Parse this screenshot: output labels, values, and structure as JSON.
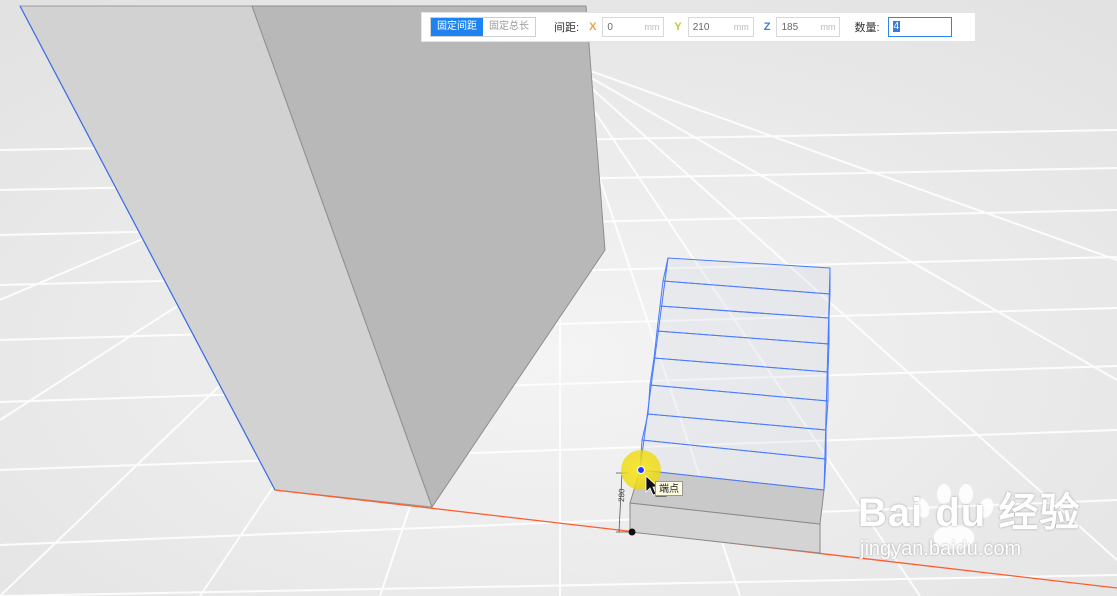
{
  "toolbar": {
    "mode_fixed_spacing": "固定间距",
    "mode_fixed_total": "固定总长",
    "spacing_label": "间距:",
    "x_axis": "X",
    "x_value": "0",
    "y_axis": "Y",
    "y_value": "210",
    "z_axis": "Z",
    "z_value": "185",
    "unit": "mm",
    "quantity_label": "数量:",
    "quantity_value": "4"
  },
  "viewport": {
    "dimension_label": "280",
    "snap_tooltip": "端点"
  },
  "watermark": {
    "brand": "Bai du 经验",
    "url": "jingyan.baidu.com"
  },
  "colors": {
    "accent": "#1e83f0",
    "selection_edge": "#4a7bff",
    "axis_red": "#ff5b2e",
    "highlight": "#f3e21a"
  }
}
